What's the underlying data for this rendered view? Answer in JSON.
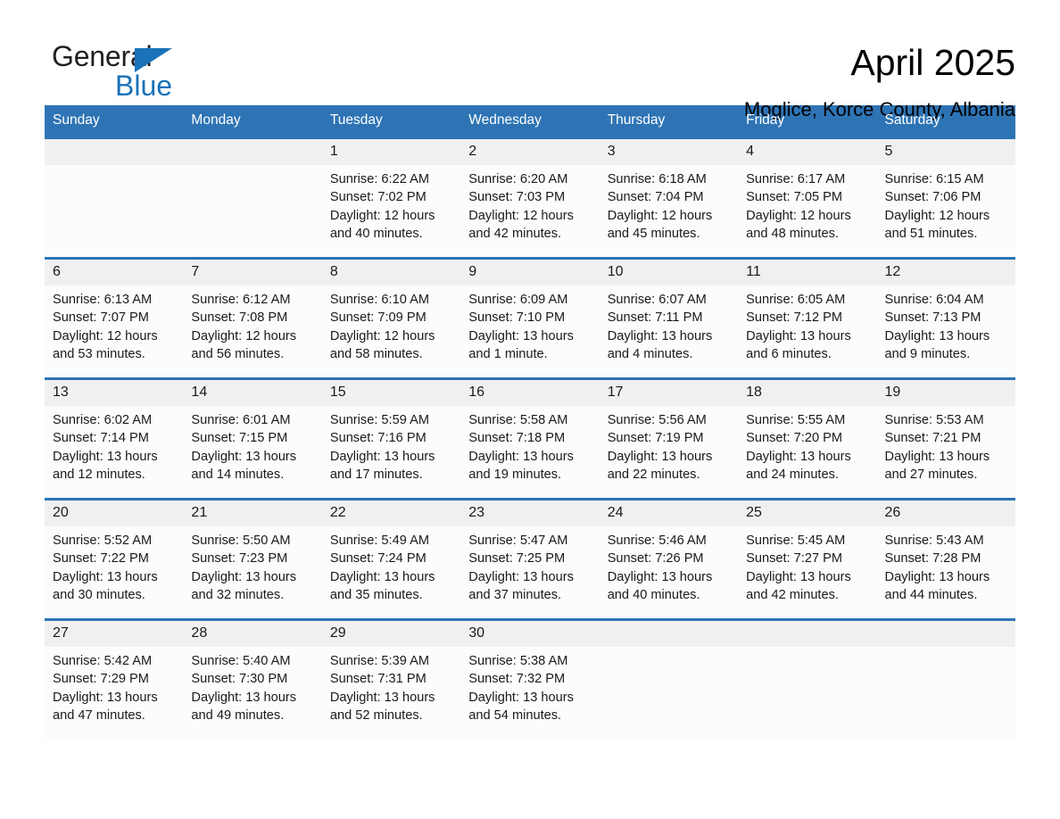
{
  "brand": {
    "name_part1": "General",
    "name_part2": "Blue",
    "triangle_icon": "triangle-icon",
    "accent_color": "#1a72b8"
  },
  "header": {
    "month_title": "April 2025",
    "location": "Moglice, Korce County, Albania"
  },
  "calendar": {
    "header_bg": "#2e74b5",
    "daynum_bg": "#f0f0f0",
    "weekday_headers": [
      "Sunday",
      "Monday",
      "Tuesday",
      "Wednesday",
      "Thursday",
      "Friday",
      "Saturday"
    ],
    "weeks": [
      [
        {
          "day": "",
          "sunrise": "",
          "sunset": "",
          "daylight": "",
          "empty": true
        },
        {
          "day": "",
          "sunrise": "",
          "sunset": "",
          "daylight": "",
          "empty": true
        },
        {
          "day": "1",
          "sunrise": "Sunrise: 6:22 AM",
          "sunset": "Sunset: 7:02 PM",
          "daylight": "Daylight: 12 hours and 40 minutes.",
          "empty": false
        },
        {
          "day": "2",
          "sunrise": "Sunrise: 6:20 AM",
          "sunset": "Sunset: 7:03 PM",
          "daylight": "Daylight: 12 hours and 42 minutes.",
          "empty": false
        },
        {
          "day": "3",
          "sunrise": "Sunrise: 6:18 AM",
          "sunset": "Sunset: 7:04 PM",
          "daylight": "Daylight: 12 hours and 45 minutes.",
          "empty": false
        },
        {
          "day": "4",
          "sunrise": "Sunrise: 6:17 AM",
          "sunset": "Sunset: 7:05 PM",
          "daylight": "Daylight: 12 hours and 48 minutes.",
          "empty": false
        },
        {
          "day": "5",
          "sunrise": "Sunrise: 6:15 AM",
          "sunset": "Sunset: 7:06 PM",
          "daylight": "Daylight: 12 hours and 51 minutes.",
          "empty": false
        }
      ],
      [
        {
          "day": "6",
          "sunrise": "Sunrise: 6:13 AM",
          "sunset": "Sunset: 7:07 PM",
          "daylight": "Daylight: 12 hours and 53 minutes.",
          "empty": false
        },
        {
          "day": "7",
          "sunrise": "Sunrise: 6:12 AM",
          "sunset": "Sunset: 7:08 PM",
          "daylight": "Daylight: 12 hours and 56 minutes.",
          "empty": false
        },
        {
          "day": "8",
          "sunrise": "Sunrise: 6:10 AM",
          "sunset": "Sunset: 7:09 PM",
          "daylight": "Daylight: 12 hours and 58 minutes.",
          "empty": false
        },
        {
          "day": "9",
          "sunrise": "Sunrise: 6:09 AM",
          "sunset": "Sunset: 7:10 PM",
          "daylight": "Daylight: 13 hours and 1 minute.",
          "empty": false
        },
        {
          "day": "10",
          "sunrise": "Sunrise: 6:07 AM",
          "sunset": "Sunset: 7:11 PM",
          "daylight": "Daylight: 13 hours and 4 minutes.",
          "empty": false
        },
        {
          "day": "11",
          "sunrise": "Sunrise: 6:05 AM",
          "sunset": "Sunset: 7:12 PM",
          "daylight": "Daylight: 13 hours and 6 minutes.",
          "empty": false
        },
        {
          "day": "12",
          "sunrise": "Sunrise: 6:04 AM",
          "sunset": "Sunset: 7:13 PM",
          "daylight": "Daylight: 13 hours and 9 minutes.",
          "empty": false
        }
      ],
      [
        {
          "day": "13",
          "sunrise": "Sunrise: 6:02 AM",
          "sunset": "Sunset: 7:14 PM",
          "daylight": "Daylight: 13 hours and 12 minutes.",
          "empty": false
        },
        {
          "day": "14",
          "sunrise": "Sunrise: 6:01 AM",
          "sunset": "Sunset: 7:15 PM",
          "daylight": "Daylight: 13 hours and 14 minutes.",
          "empty": false
        },
        {
          "day": "15",
          "sunrise": "Sunrise: 5:59 AM",
          "sunset": "Sunset: 7:16 PM",
          "daylight": "Daylight: 13 hours and 17 minutes.",
          "empty": false
        },
        {
          "day": "16",
          "sunrise": "Sunrise: 5:58 AM",
          "sunset": "Sunset: 7:18 PM",
          "daylight": "Daylight: 13 hours and 19 minutes.",
          "empty": false
        },
        {
          "day": "17",
          "sunrise": "Sunrise: 5:56 AM",
          "sunset": "Sunset: 7:19 PM",
          "daylight": "Daylight: 13 hours and 22 minutes.",
          "empty": false
        },
        {
          "day": "18",
          "sunrise": "Sunrise: 5:55 AM",
          "sunset": "Sunset: 7:20 PM",
          "daylight": "Daylight: 13 hours and 24 minutes.",
          "empty": false
        },
        {
          "day": "19",
          "sunrise": "Sunrise: 5:53 AM",
          "sunset": "Sunset: 7:21 PM",
          "daylight": "Daylight: 13 hours and 27 minutes.",
          "empty": false
        }
      ],
      [
        {
          "day": "20",
          "sunrise": "Sunrise: 5:52 AM",
          "sunset": "Sunset: 7:22 PM",
          "daylight": "Daylight: 13 hours and 30 minutes.",
          "empty": false
        },
        {
          "day": "21",
          "sunrise": "Sunrise: 5:50 AM",
          "sunset": "Sunset: 7:23 PM",
          "daylight": "Daylight: 13 hours and 32 minutes.",
          "empty": false
        },
        {
          "day": "22",
          "sunrise": "Sunrise: 5:49 AM",
          "sunset": "Sunset: 7:24 PM",
          "daylight": "Daylight: 13 hours and 35 minutes.",
          "empty": false
        },
        {
          "day": "23",
          "sunrise": "Sunrise: 5:47 AM",
          "sunset": "Sunset: 7:25 PM",
          "daylight": "Daylight: 13 hours and 37 minutes.",
          "empty": false
        },
        {
          "day": "24",
          "sunrise": "Sunrise: 5:46 AM",
          "sunset": "Sunset: 7:26 PM",
          "daylight": "Daylight: 13 hours and 40 minutes.",
          "empty": false
        },
        {
          "day": "25",
          "sunrise": "Sunrise: 5:45 AM",
          "sunset": "Sunset: 7:27 PM",
          "daylight": "Daylight: 13 hours and 42 minutes.",
          "empty": false
        },
        {
          "day": "26",
          "sunrise": "Sunrise: 5:43 AM",
          "sunset": "Sunset: 7:28 PM",
          "daylight": "Daylight: 13 hours and 44 minutes.",
          "empty": false
        }
      ],
      [
        {
          "day": "27",
          "sunrise": "Sunrise: 5:42 AM",
          "sunset": "Sunset: 7:29 PM",
          "daylight": "Daylight: 13 hours and 47 minutes.",
          "empty": false
        },
        {
          "day": "28",
          "sunrise": "Sunrise: 5:40 AM",
          "sunset": "Sunset: 7:30 PM",
          "daylight": "Daylight: 13 hours and 49 minutes.",
          "empty": false
        },
        {
          "day": "29",
          "sunrise": "Sunrise: 5:39 AM",
          "sunset": "Sunset: 7:31 PM",
          "daylight": "Daylight: 13 hours and 52 minutes.",
          "empty": false
        },
        {
          "day": "30",
          "sunrise": "Sunrise: 5:38 AM",
          "sunset": "Sunset: 7:32 PM",
          "daylight": "Daylight: 13 hours and 54 minutes.",
          "empty": false
        },
        {
          "day": "",
          "sunrise": "",
          "sunset": "",
          "daylight": "",
          "empty": true
        },
        {
          "day": "",
          "sunrise": "",
          "sunset": "",
          "daylight": "",
          "empty": true
        },
        {
          "day": "",
          "sunrise": "",
          "sunset": "",
          "daylight": "",
          "empty": true
        }
      ]
    ]
  }
}
